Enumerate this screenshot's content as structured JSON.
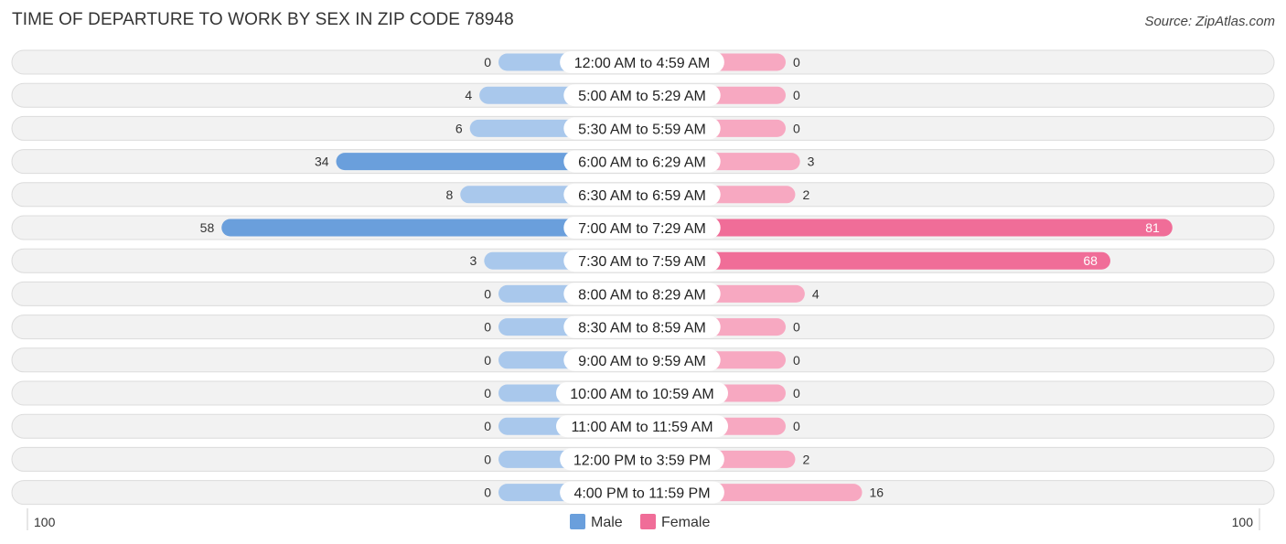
{
  "header": {
    "title": "TIME OF DEPARTURE TO WORK BY SEX IN ZIP CODE 78948",
    "source": "Source: ZipAtlas.com"
  },
  "colors": {
    "male": "#6a9fdc",
    "male_light": "#a9c8ec",
    "female": "#f06d98",
    "female_light": "#f7a8c1"
  },
  "chart_data": {
    "type": "bar",
    "orientation": "horizontal-diverging",
    "title": "TIME OF DEPARTURE TO WORK BY SEX IN ZIP CODE 78948",
    "categories": [
      "12:00 AM to 4:59 AM",
      "5:00 AM to 5:29 AM",
      "5:30 AM to 5:59 AM",
      "6:00 AM to 6:29 AM",
      "6:30 AM to 6:59 AM",
      "7:00 AM to 7:29 AM",
      "7:30 AM to 7:59 AM",
      "8:00 AM to 8:29 AM",
      "8:30 AM to 8:59 AM",
      "9:00 AM to 9:59 AM",
      "10:00 AM to 10:59 AM",
      "11:00 AM to 11:59 AM",
      "12:00 PM to 3:59 PM",
      "4:00 PM to 11:59 PM"
    ],
    "series": [
      {
        "name": "Male",
        "values": [
          0,
          4,
          6,
          34,
          8,
          58,
          3,
          0,
          0,
          0,
          0,
          0,
          0,
          0
        ]
      },
      {
        "name": "Female",
        "values": [
          0,
          0,
          0,
          3,
          2,
          81,
          68,
          4,
          0,
          0,
          0,
          0,
          2,
          16
        ]
      }
    ],
    "axis": {
      "left_label": "100",
      "right_label": "100",
      "range": [
        0,
        100
      ]
    },
    "legend": {
      "position": "bottom-center",
      "items": [
        "Male",
        "Female"
      ]
    }
  }
}
